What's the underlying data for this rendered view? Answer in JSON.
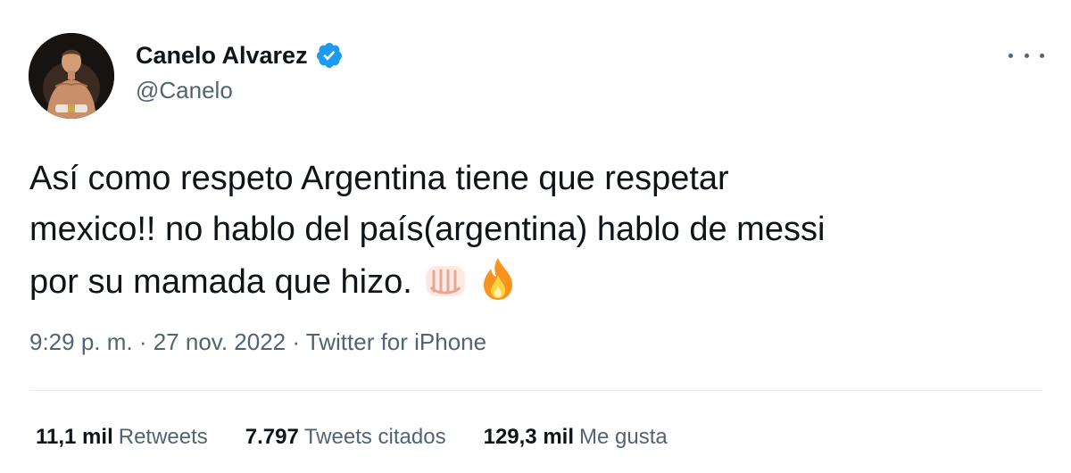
{
  "author": {
    "display_name": "Canelo Alvarez",
    "handle": "@Canelo",
    "verified": true
  },
  "tweet": {
    "lines": [
      "Así como respeto Argentina tiene que respetar",
      "mexico!! no hablo del país(argentina) hablo de messi",
      "por su mamada que hizo."
    ],
    "emojis": [
      "fist-emoji",
      "fire-emoji"
    ],
    "timestamp": "9:29 p. m. · 27 nov. 2022 · ",
    "source": "Twitter for iPhone"
  },
  "stats": {
    "retweets_value": "11,1 mil",
    "retweets_label": "Retweets",
    "quotes_value": "7.797",
    "quotes_label": "Tweets citados",
    "likes_value": "129,3 mil",
    "likes_label": "Me gusta"
  },
  "colors": {
    "text_primary": "#0f1419",
    "text_secondary": "#536471",
    "verified_blue": "#1d9bf0",
    "divider": "#e6ecf0"
  }
}
